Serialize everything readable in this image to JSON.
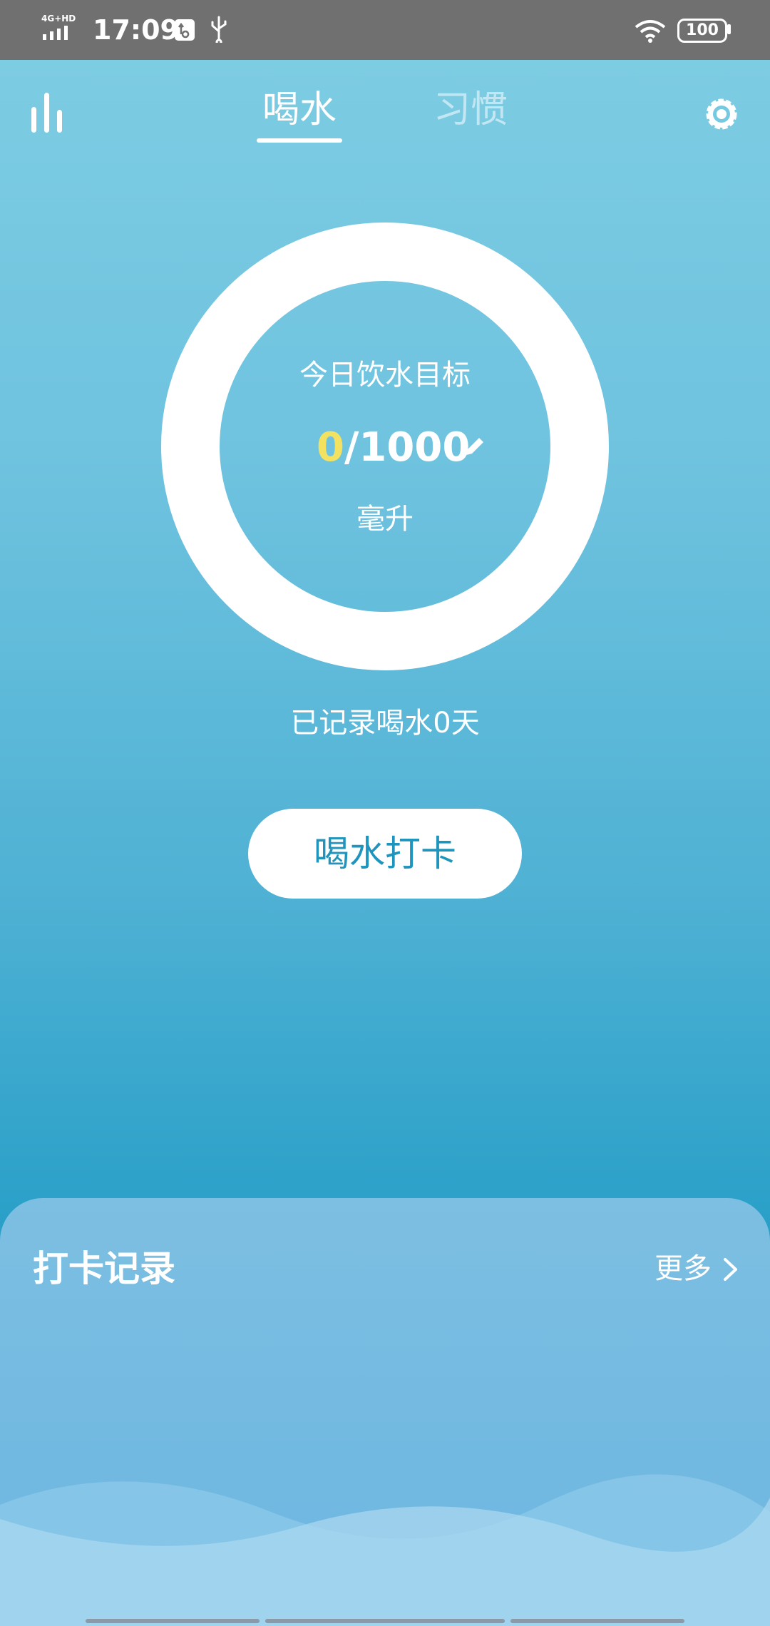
{
  "status_bar": {
    "network": "4G+HD",
    "time": "17:09",
    "battery": "100",
    "icons": [
      "signal-icon",
      "usb-settings-icon",
      "usb-icon",
      "wifi-icon",
      "battery-icon"
    ]
  },
  "header": {
    "tabs": [
      {
        "label": "喝水",
        "active": true
      },
      {
        "label": "习惯",
        "active": false
      }
    ],
    "left_icon": "bar-chart-icon",
    "right_icon": "gear-icon"
  },
  "goal": {
    "label": "今日饮水目标",
    "current": "0",
    "target": "/1000",
    "unit": "毫升",
    "progress": 0
  },
  "record_days_text": "已记录喝水0天",
  "checkin_button": "喝水打卡",
  "records": {
    "title": "打卡记录",
    "more": "更多"
  },
  "colors": {
    "accent": "#1f94bd",
    "current_value": "#f3e25f",
    "background_top": "#7ecde3",
    "background_bottom": "#2a9ec8"
  }
}
